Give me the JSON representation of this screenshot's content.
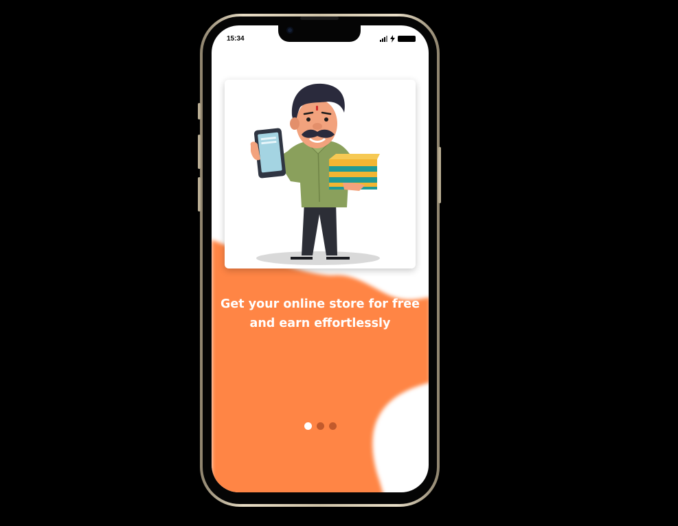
{
  "status_bar": {
    "time": "15:34",
    "icons": [
      "signal-icon",
      "charging-icon",
      "battery-icon"
    ]
  },
  "onboarding": {
    "illustration": "shopkeeper-with-phone-and-box",
    "tagline_line1": "Get your online store for free",
    "tagline_line2": "and earn effortlessly",
    "page_count": 3,
    "active_page": 1
  },
  "colors": {
    "accent": "#ff8545",
    "inactive_dot": "#c25a2c",
    "active_dot": "#ffffff"
  }
}
